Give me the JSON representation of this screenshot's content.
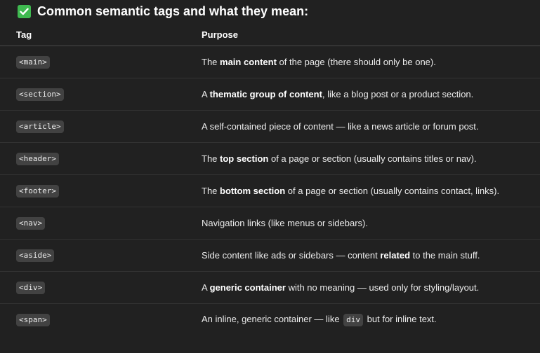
{
  "heading": {
    "icon": "check-mark-button-icon",
    "icon_color": "#3fb950",
    "title": "Common semantic tags and what they mean:"
  },
  "table": {
    "headers": {
      "tag": "Tag",
      "purpose": "Purpose"
    },
    "rows": [
      {
        "tag": "<main>",
        "p1": "The ",
        "b": "main content",
        "p2": " of the page (there should only be one).",
        "code": "",
        "p3": ""
      },
      {
        "tag": "<section>",
        "p1": "A ",
        "b": "thematic group of content",
        "p2": ", like a blog post or a product section.",
        "code": "",
        "p3": ""
      },
      {
        "tag": "<article>",
        "p1": "A self-contained piece of content — like a news article or forum post.",
        "b": "",
        "p2": "",
        "code": "",
        "p3": ""
      },
      {
        "tag": "<header>",
        "p1": "The ",
        "b": "top section",
        "p2": " of a page or section (usually contains titles or nav).",
        "code": "",
        "p3": ""
      },
      {
        "tag": "<footer>",
        "p1": "The ",
        "b": "bottom section",
        "p2": " of a page or section (usually contains contact, links).",
        "code": "",
        "p3": ""
      },
      {
        "tag": "<nav>",
        "p1": "Navigation links (like menus or sidebars).",
        "b": "",
        "p2": "",
        "code": "",
        "p3": ""
      },
      {
        "tag": "<aside>",
        "p1": "Side content like ads or sidebars — content ",
        "b": "related",
        "p2": " to the main stuff.",
        "code": "",
        "p3": ""
      },
      {
        "tag": "<div>",
        "p1": "A ",
        "b": "generic container",
        "p2": " with no meaning — used only for styling/layout.",
        "code": "",
        "p3": ""
      },
      {
        "tag": "<span>",
        "p1": "An inline, generic container — like ",
        "b": "",
        "p2": "",
        "code": "div",
        "p3": " but for inline text."
      }
    ]
  }
}
